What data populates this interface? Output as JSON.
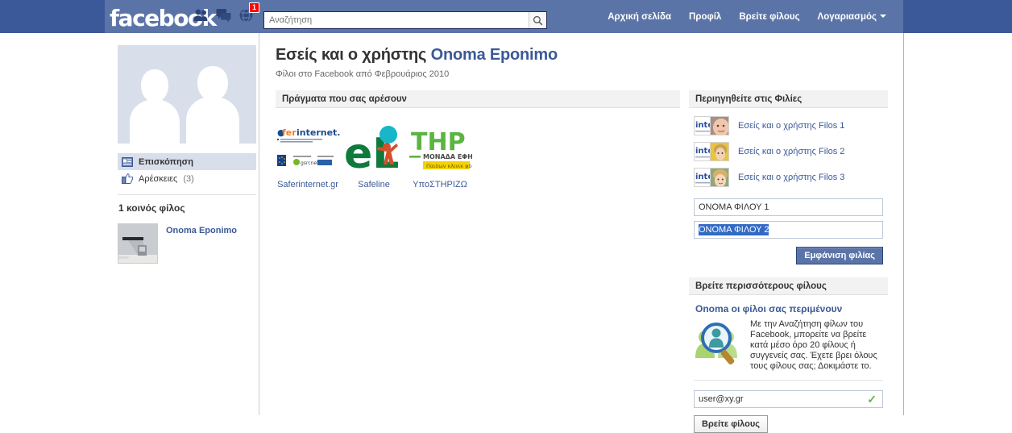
{
  "header": {
    "logo": "facebook",
    "icons": [
      {
        "name": "friend-requests-icon",
        "badge": null
      },
      {
        "name": "messages-icon",
        "badge": null
      },
      {
        "name": "notifications-globe-icon",
        "badge": "1"
      }
    ],
    "search": {
      "placeholder": "Αναζήτηση",
      "value": "",
      "button_icon": "search-icon"
    },
    "nav": [
      {
        "label": "Αρχική σελίδα",
        "caret": false
      },
      {
        "label": "Προφίλ",
        "caret": false
      },
      {
        "label": "Βρείτε φίλους",
        "caret": false
      },
      {
        "label": "Λογαριασμός",
        "caret": true
      }
    ]
  },
  "sidebar": {
    "profile_photo_alt": "two-silhouettes-placeholder",
    "items": [
      {
        "label": "Επισκόπηση",
        "count": "",
        "icon": "overview-icon",
        "selected": true
      },
      {
        "label": "Αρέσκειες",
        "count": "(3)",
        "icon": "thumbs-up-icon",
        "selected": false
      }
    ],
    "mutual_title": "1 κοινός φίλος",
    "mutual_friends": [
      {
        "name": "Onoma Eponimo"
      }
    ]
  },
  "main": {
    "title_prefix": "Εσείς και ο χρήστης",
    "title_name": "Onoma Eponimo",
    "subtitle": "Φίλοι στο Facebook από Φεβρουάριος 2010",
    "likes_header": "Πράγματα που σας αρέσουν",
    "likes": [
      {
        "name": "Saferinternet.gr",
        "logo": "saferinternet-logo"
      },
      {
        "name": "Safeline",
        "logo": "safeline-logo"
      },
      {
        "name": "ΥποΣΤΗΡΙΖΩ",
        "logo": "ypostirizo-logo"
      }
    ]
  },
  "right": {
    "browse_header": "Περιηγηθείτε στις Φιλίες",
    "friendships": [
      {
        "label": "Εσείς και ο χρήστης Filos 1"
      },
      {
        "label": "Εσείς και ο χρήστης Filos 2"
      },
      {
        "label": "Εσείς και ο χρήστης Filos 3"
      }
    ],
    "friend1_field": {
      "value": "ΟΝΟΜΑ ΦΙΛΟΥ 1",
      "placeholder": ""
    },
    "friend2_field": {
      "value": "ΟΝΟΜΑ ΦΙΛΟΥ 2",
      "placeholder": "",
      "selected": true
    },
    "show_friendship_button": "Εμφάνιση φιλίας",
    "find_more_header": "Βρείτε περισσότερους φίλους",
    "find_more_title": "Onoma οι φίλοι σας περιμένουν",
    "find_more_text": "Με την Αναζήτηση φίλων του Facebook, μπορείτε να βρείτε κατά μέσο όρο 20 φίλους ή συγγενείς σας. Έχετε βρει όλους τους φίλους σας; Δοκιμάστε το.",
    "email_field": {
      "value": "user@xy.gr",
      "placeholder": "",
      "valid_icon": "green-check-icon"
    },
    "find_friends_button": "Βρείτε φίλους"
  },
  "colors": {
    "fb_blue": "#3b5998",
    "nav_panel": "#5b74a8",
    "link": "#3b5998",
    "selection": "#316ac5",
    "valid_green": "#6ab04a",
    "badge_red": "#ff0000"
  }
}
